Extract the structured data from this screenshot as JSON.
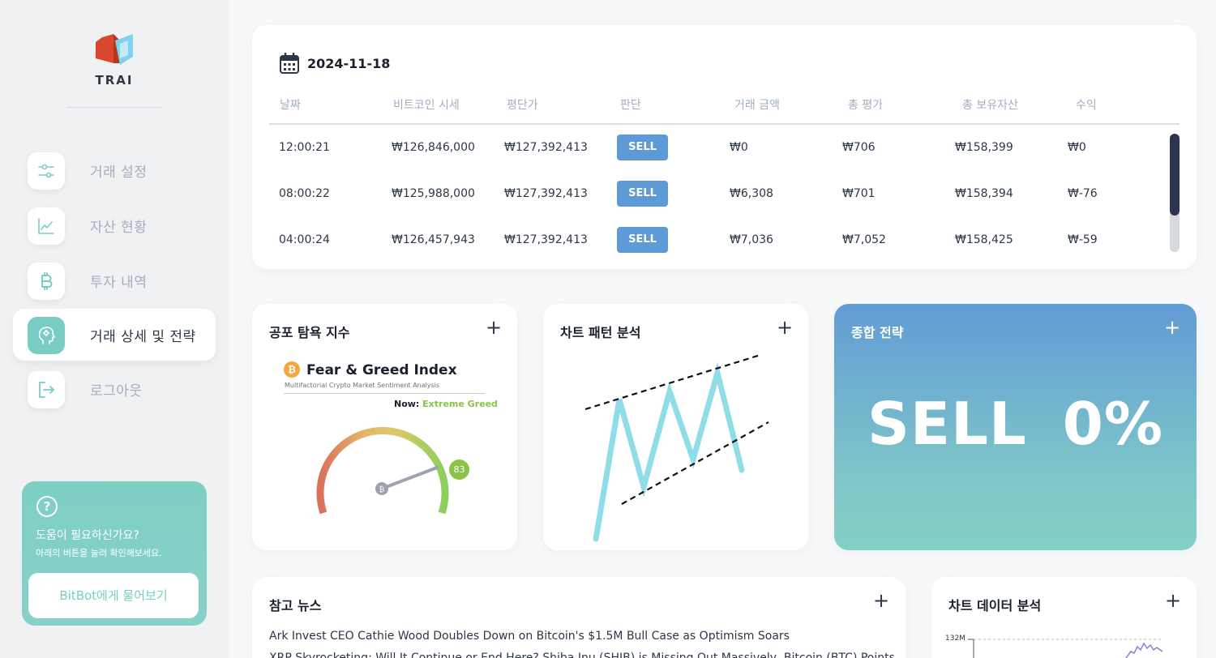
{
  "app": {
    "name": "TRAI",
    "logo_icon": "trai-logo",
    "accent": "#79cdc3"
  },
  "sidebar": {
    "items": [
      {
        "label": "거래 설정",
        "icon": "sliders-icon",
        "active": false
      },
      {
        "label": "자산 현황",
        "icon": "line-chart-icon",
        "active": false
      },
      {
        "label": "투자 내역",
        "icon": "bitcoin-icon",
        "active": false
      },
      {
        "label": "거래 상세 및 전략",
        "icon": "brain-head-icon",
        "active": true
      },
      {
        "label": "로그아웃",
        "icon": "logout-icon",
        "active": false
      }
    ],
    "help": {
      "icon": "question-icon",
      "title": "도움이 필요하신가요?",
      "subtitle": "아래의 버튼을 눌러 확인해보세요.",
      "button": "BitBot에게 물어보기"
    }
  },
  "trades": {
    "date": "2024-11-18",
    "date_icon": "calendar-icon",
    "columns": [
      "날짜",
      "비트코인 시세",
      "평단가",
      "판단",
      "거래 금액",
      "총 평가",
      "총 보유자산",
      "수익"
    ],
    "rows": [
      {
        "time": "12:00:21",
        "price": "₩126,846,000",
        "avg": "₩127,392,413",
        "decision": "SELL",
        "amount": "₩0",
        "valuation": "₩706",
        "assets": "₩158,399",
        "profit": "₩0"
      },
      {
        "time": "08:00:22",
        "price": "₩125,988,000",
        "avg": "₩127,392,413",
        "decision": "SELL",
        "amount": "₩6,308",
        "valuation": "₩701",
        "assets": "₩158,394",
        "profit": "₩-76"
      },
      {
        "time": "04:00:24",
        "price": "₩126,457,943",
        "avg": "₩127,392,413",
        "decision": "SELL",
        "amount": "₩7,036",
        "valuation": "₩7,052",
        "assets": "₩158,425",
        "profit": "₩-59"
      }
    ]
  },
  "fear_greed": {
    "title": "공포 탐욕 지수",
    "plus": "+",
    "index_title": "Fear & Greed Index",
    "index_subtitle": "Multifactorial Crypto Market Sentiment Analysis",
    "now_label": "Now:",
    "now_value": "Extreme Greed",
    "value": "83",
    "value_color": "#8bc34a"
  },
  "pattern": {
    "title": "차트 패턴 분석",
    "plus": "+"
  },
  "strategy": {
    "title": "종합 전략",
    "plus": "+",
    "action": "SELL",
    "percent": "0%"
  },
  "news": {
    "title": "참고 뉴스",
    "plus": "+",
    "items": [
      "Ark Invest CEO Cathie Wood Doubles Down on Bitcoin's $1.5M Bull Case as Optimism Soars",
      "XRP Skyrocketing: Will It Continue or End Here? Shiba Inu (SHIB) is Missing Out Massively, Bitcoin (BTC) Points"
    ]
  },
  "chart_data_card": {
    "title": "차트 데이터 분석",
    "plus": "+",
    "ylabel_top": "132M"
  }
}
